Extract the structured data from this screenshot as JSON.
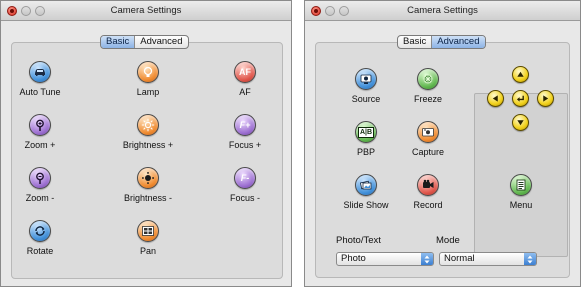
{
  "windows": [
    {
      "title": "Camera Settings",
      "tabs": [
        {
          "label": "Basic",
          "selected": true
        },
        {
          "label": "Advanced",
          "selected": false
        }
      ],
      "buttons": [
        {
          "label": "Auto Tune",
          "icon": "car-icon"
        },
        {
          "label": "Lamp",
          "icon": "lamp-icon"
        },
        {
          "label": "AF",
          "icon": "af-icon"
        },
        {
          "label": "Zoom +",
          "icon": "zoom-in-icon"
        },
        {
          "label": "Brightness +",
          "icon": "brightness-up-icon"
        },
        {
          "label": "Focus +",
          "icon": "focus-plus-icon"
        },
        {
          "label": "Zoom -",
          "icon": "zoom-out-icon"
        },
        {
          "label": "Brightness -",
          "icon": "brightness-down-icon"
        },
        {
          "label": "Focus -",
          "icon": "focus-minus-icon"
        },
        {
          "label": "Rotate",
          "icon": "rotate-icon"
        },
        {
          "label": "Pan",
          "icon": "pan-icon"
        }
      ],
      "icon_text": {
        "af": "AF",
        "focus_plus": "F+",
        "focus_minus": "F-"
      }
    },
    {
      "title": "Camera Settings",
      "tabs": [
        {
          "label": "Basic",
          "selected": false
        },
        {
          "label": "Advanced",
          "selected": true
        }
      ],
      "buttons": [
        {
          "label": "Source",
          "icon": "source-icon"
        },
        {
          "label": "Freeze",
          "icon": "freeze-icon"
        },
        {
          "label": "PBP",
          "icon": "pbp-icon"
        },
        {
          "label": "Capture",
          "icon": "capture-icon"
        },
        {
          "label": "Slide Show",
          "icon": "slide-show-icon"
        },
        {
          "label": "Record",
          "icon": "record-icon"
        },
        {
          "label": "Menu",
          "icon": "menu-icon"
        }
      ],
      "dpad": {
        "up": "arrow-up-icon",
        "down": "arrow-down-icon",
        "left": "arrow-left-icon",
        "right": "arrow-right-icon",
        "center": "enter-icon"
      },
      "fields": {
        "photo_text": {
          "label": "Photo/Text",
          "value": "Photo"
        },
        "mode": {
          "label": "Mode",
          "value": "Normal"
        }
      },
      "icon_text": {
        "pbp": "A|B"
      }
    }
  ],
  "colors": {
    "tab_selected": "#8db3e5",
    "close_button": "#d3281b",
    "accent_blue": "#3b7fd1"
  }
}
